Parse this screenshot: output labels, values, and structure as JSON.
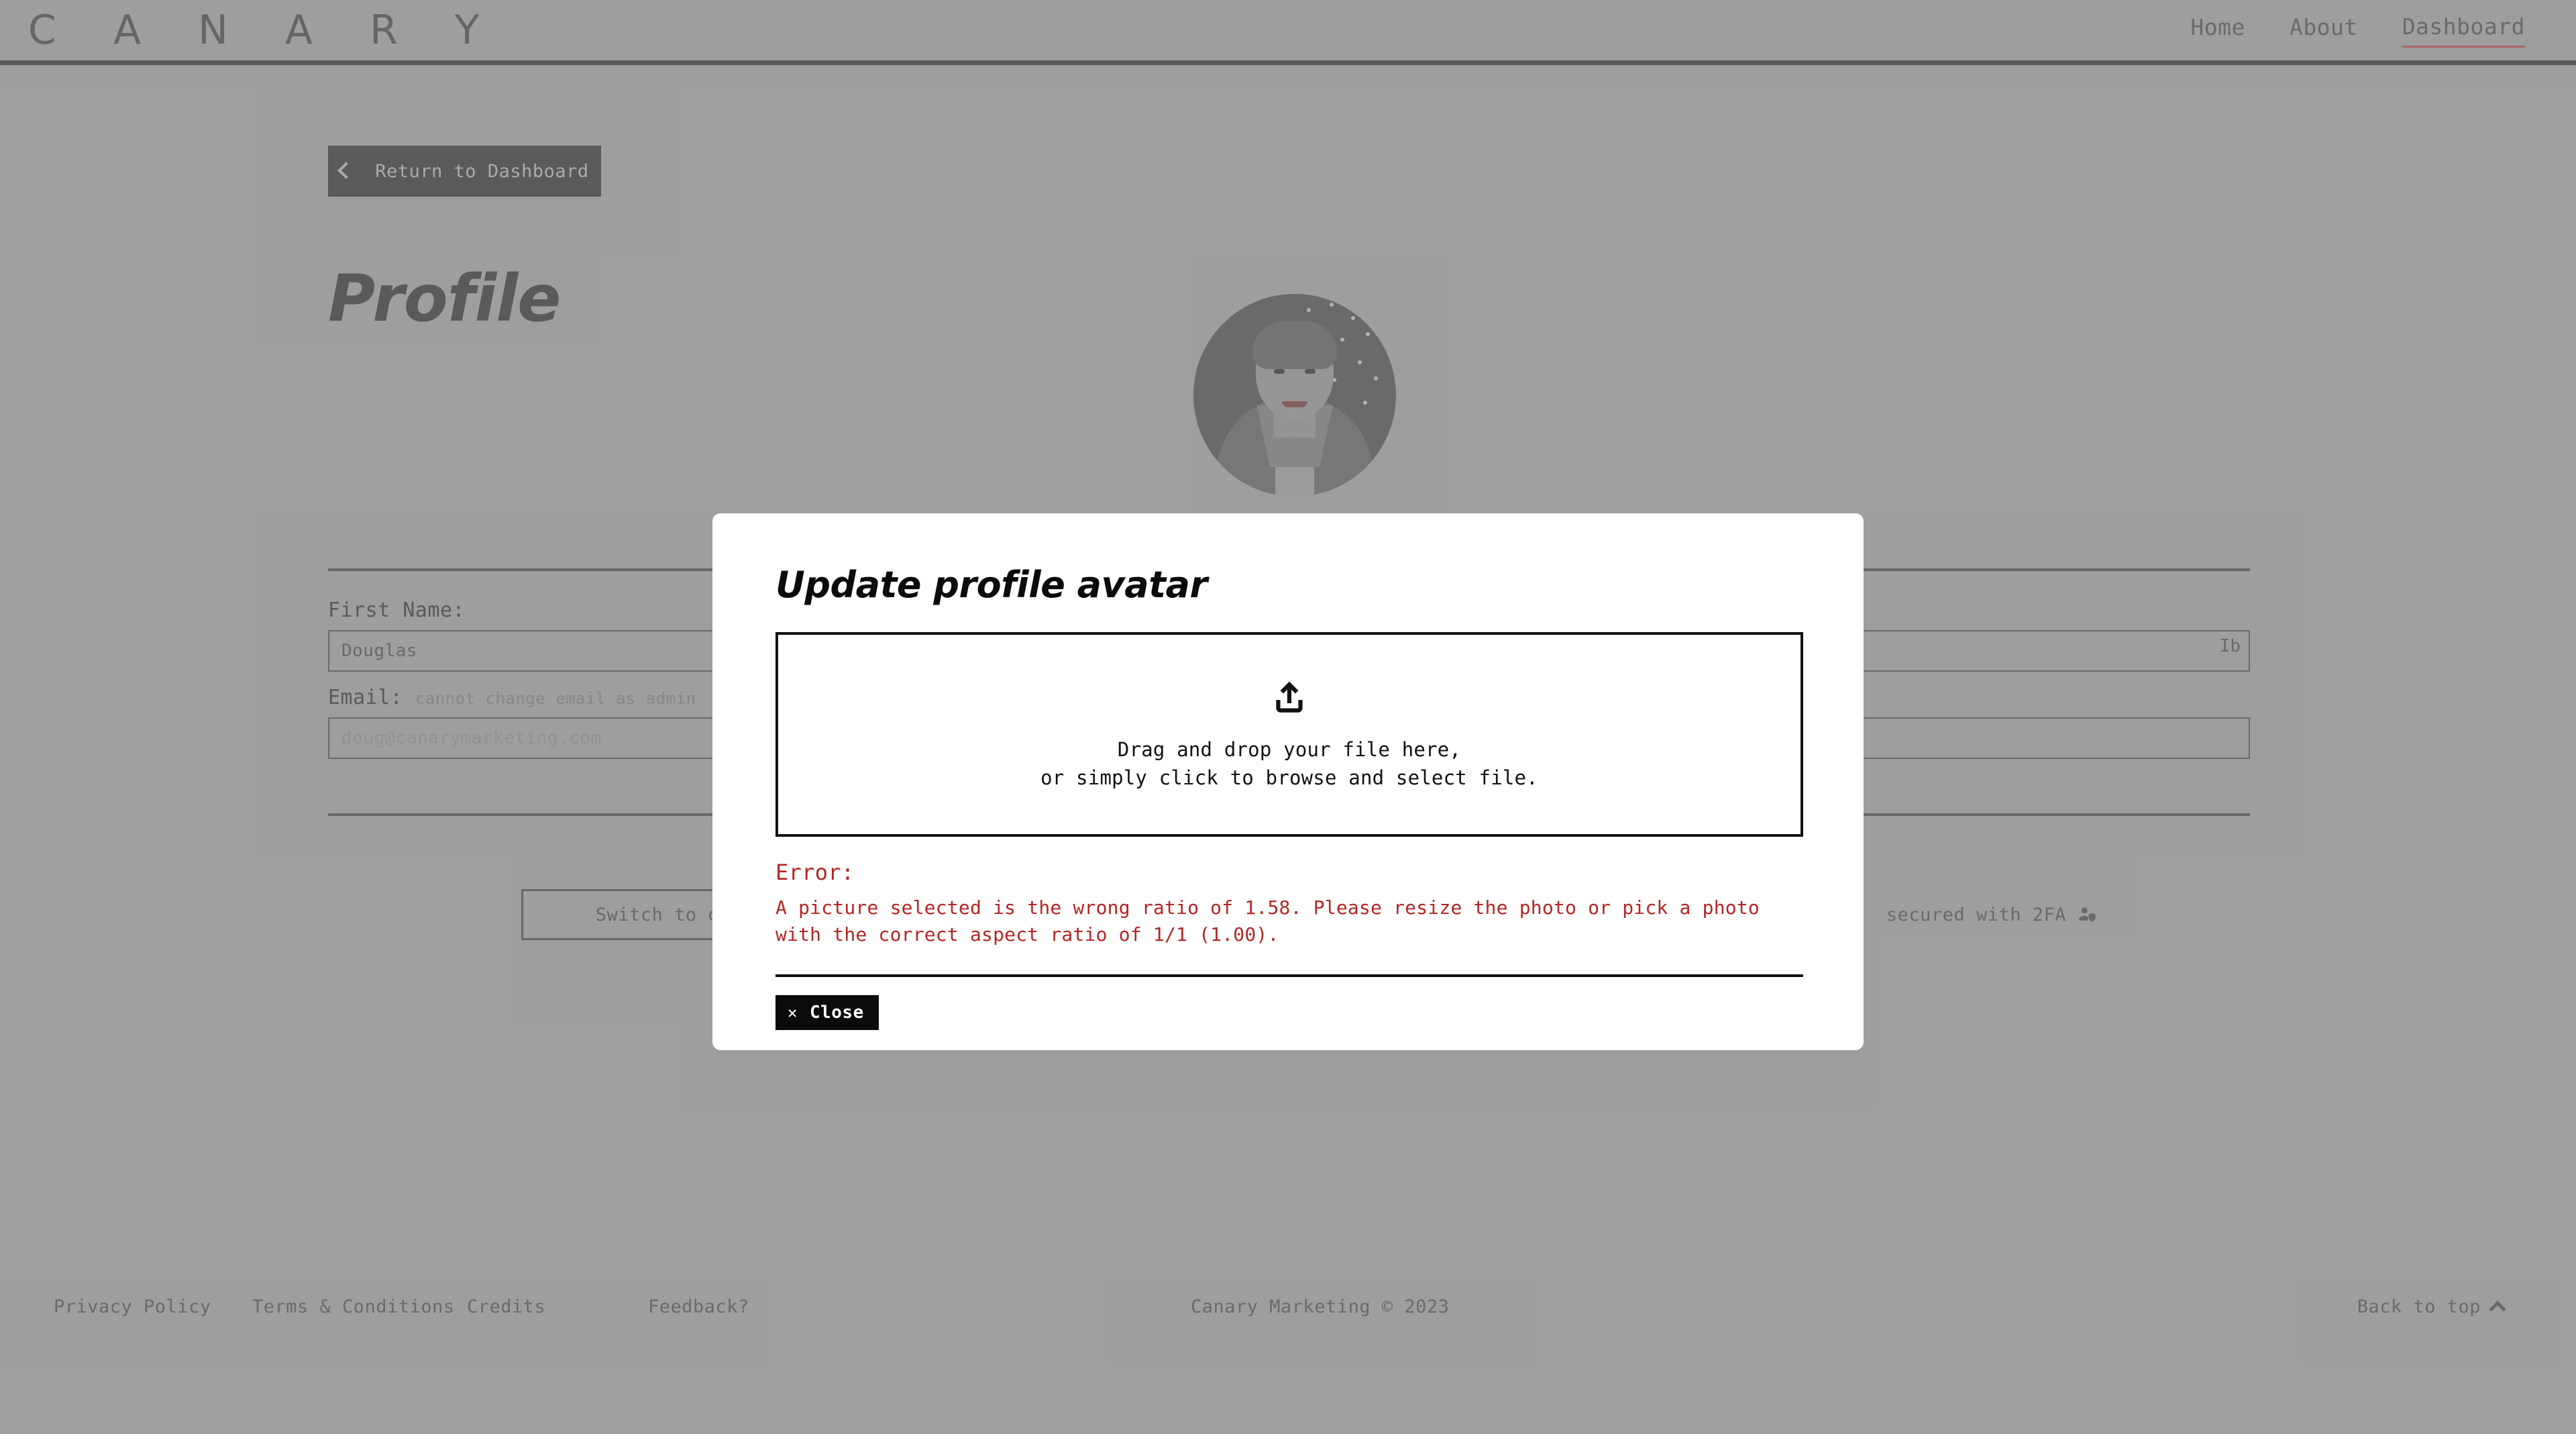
{
  "header": {
    "brand": "C A N A R Y",
    "nav": [
      {
        "label": "Home",
        "active": false
      },
      {
        "label": "About",
        "active": false
      },
      {
        "label": "Dashboard",
        "active": true
      }
    ],
    "active_accent": "#b36a6a"
  },
  "main": {
    "return_button": "Return to Dashboard",
    "page_title": "Profile",
    "avatar_alt": "profile-photo",
    "form": {
      "first_name_label": "First Name:",
      "first_name_value": "Douglas",
      "first_name_caret": "Ib",
      "email_label": "Email:",
      "email_hint": "cannot change email as admin",
      "email_value": "doug@canarymarketing.com"
    },
    "dark_mode_button": "Switch to dark mode",
    "twofa_text": "secured with 2FA",
    "twofa_icon": "person-shield-icon"
  },
  "modal": {
    "title": "Update profile avatar",
    "upload_icon": "upload-icon",
    "dropzone_line1": "Drag and drop your file here,",
    "dropzone_line2": "or simply click to browse and select file.",
    "error_heading": "Error:",
    "error_body": "A picture selected is the wrong ratio of 1.58. Please resize the photo or pick a photo with the correct aspect ratio of 1/1 (1.00).",
    "error_color": "#b32525",
    "close_label": "Close",
    "close_icon": "close-x-icon"
  },
  "footer": {
    "links": [
      {
        "label": "Privacy Policy"
      },
      {
        "label": "Terms & Conditions"
      },
      {
        "label": "Credits"
      },
      {
        "label": "Feedback?"
      }
    ],
    "copyright": "Canary Marketing © 2023",
    "back_to_top": "Back to top"
  }
}
